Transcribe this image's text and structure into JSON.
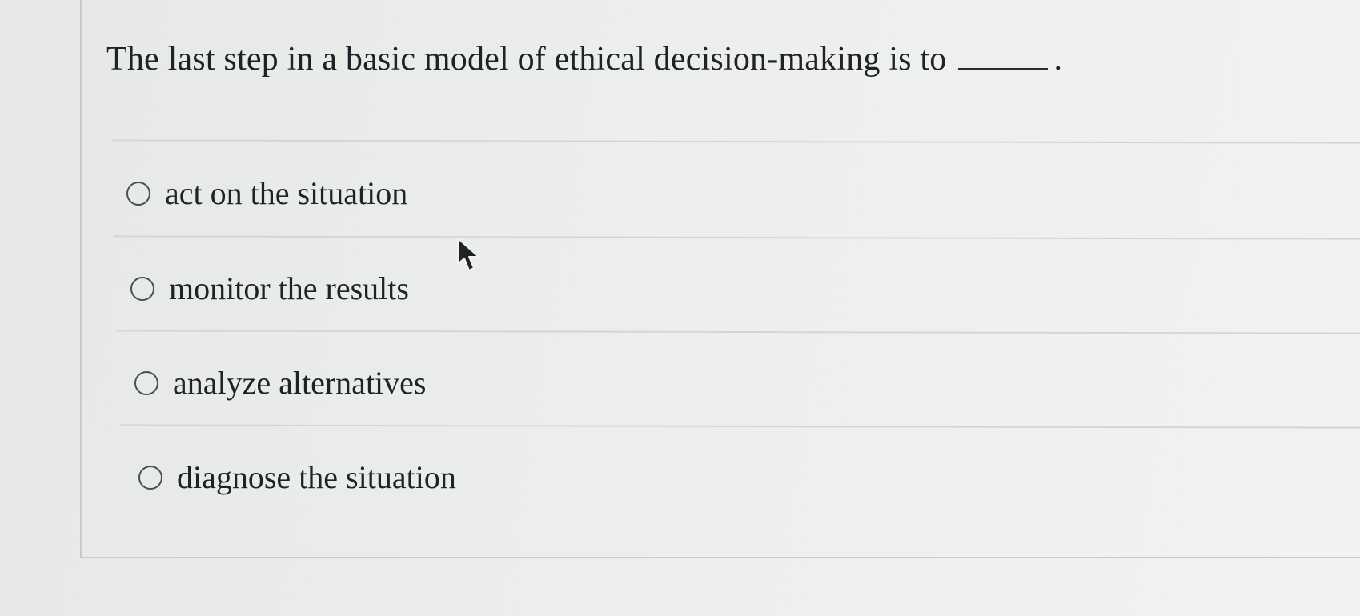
{
  "question": {
    "text": "The last step in a basic model of ethical decision-making is to",
    "end_punct": "."
  },
  "options": [
    {
      "label": "act on the situation"
    },
    {
      "label": "monitor the results"
    },
    {
      "label": "analyze alternatives"
    },
    {
      "label": "diagnose the situation"
    }
  ],
  "colors": {
    "text": "#1f2226",
    "radio_border": "#4a4e52",
    "divider": "#d3d6d4"
  },
  "icons": {
    "cursor": "mouse-pointer-arrow-icon"
  }
}
